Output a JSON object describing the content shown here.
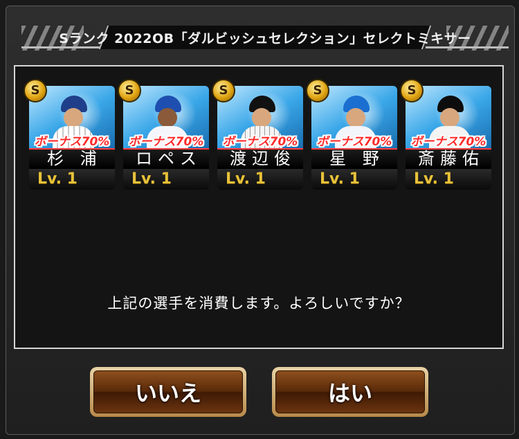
{
  "dialog": {
    "title": "Sランク 2022OB「ダルビッシュセレクション」セレクトミキサー",
    "message": "上記の選手を消費します。よろしいですか？"
  },
  "cards": [
    {
      "name": "杉 浦",
      "bonus": "ボーナス70%",
      "level": "Lv. 1",
      "rank": "S",
      "uniform": "pinstripe"
    },
    {
      "name": "ロペス",
      "bonus": "ボーナス70%",
      "level": "Lv. 1",
      "rank": "S",
      "uniform": "white"
    },
    {
      "name": "渡辺俊",
      "bonus": "ボーナス70%",
      "level": "Lv. 1",
      "rank": "S",
      "uniform": "pinstripe"
    },
    {
      "name": "星 野",
      "bonus": "ボーナス70%",
      "level": "Lv. 1",
      "rank": "S",
      "uniform": "white"
    },
    {
      "name": "斎藤佑",
      "bonus": "ボーナス70%",
      "level": "Lv. 1",
      "rank": "S",
      "uniform": "white"
    }
  ],
  "buttons": {
    "no_label": "いいえ",
    "yes_label": "はい"
  },
  "colors": {
    "bonus": "#ff2b2b",
    "level": "#e8c23a",
    "card_background": "#3aa7e8",
    "button": "#5a2a0a"
  },
  "icons": {
    "rank_badge": "s-rank-icon"
  }
}
